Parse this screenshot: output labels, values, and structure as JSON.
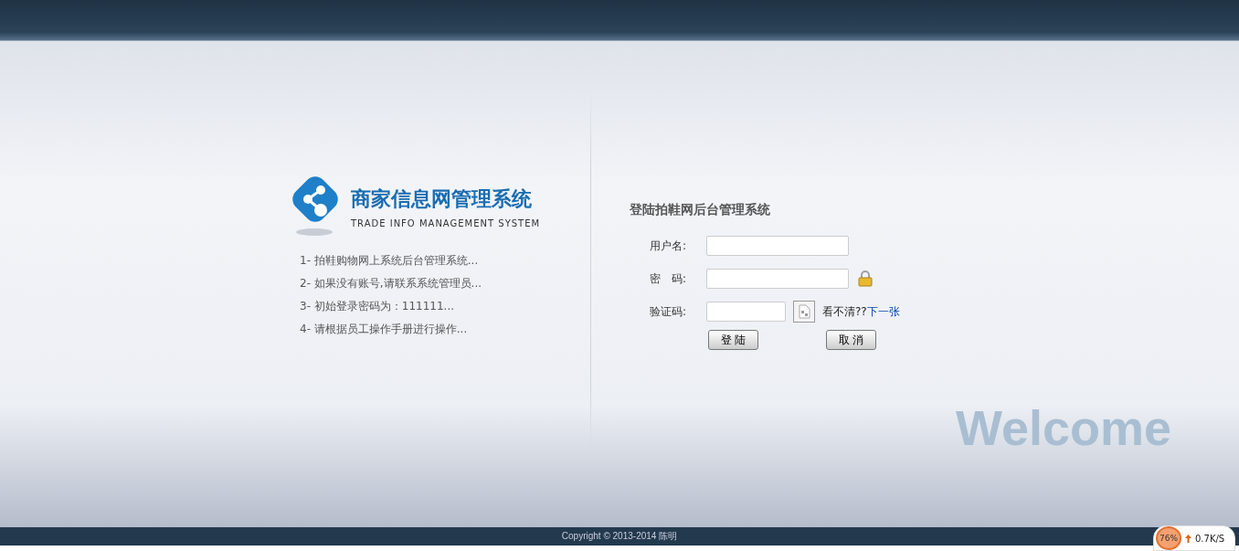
{
  "logo": {
    "title": "商家信息网管理系统",
    "subtitle": "TRADE INFO MANAGEMENT SYSTEM"
  },
  "notes": [
    "1- 拍鞋购物网上系统后台管理系统...",
    "2- 如果没有账号,请联系系统管理员...",
    "3- 初始登录密码为：111111...",
    "4- 请根据员工操作手册进行操作..."
  ],
  "login": {
    "title": "登陆拍鞋网后台管理系统",
    "username_label": "用户名:",
    "password_label": "密　码:",
    "captcha_label": "验证码:",
    "captcha_hint": "看不清??",
    "captcha_next": "下一张",
    "submit": "登 陆",
    "cancel": "取 消"
  },
  "welcome": "Welcome",
  "footer": {
    "copyright": "Copyright © 2013-2014 陈明"
  },
  "speed_meter": {
    "percent": "76%",
    "speed": "0.7K/S"
  }
}
